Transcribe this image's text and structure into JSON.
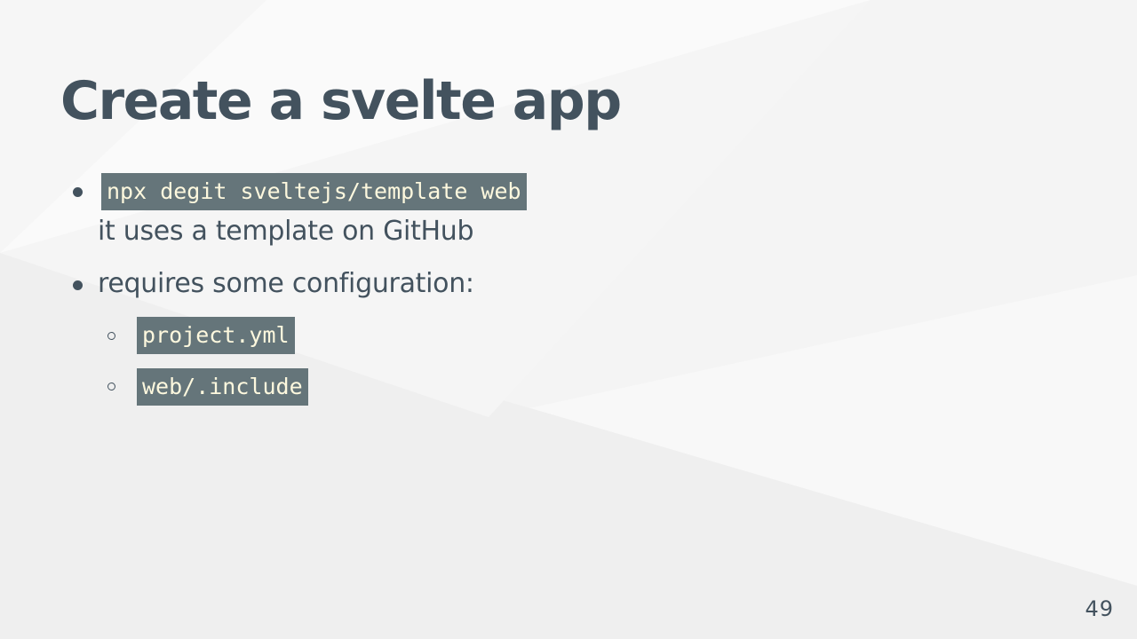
{
  "slide": {
    "title": "Create a svelte app",
    "bullets": [
      {
        "code": "npx degit sveltejs/template web",
        "text": "it uses a template on GitHub"
      },
      {
        "text": "requires some configuration:",
        "sub_items": [
          {
            "code": "project.yml"
          },
          {
            "code": "web/.include"
          }
        ]
      }
    ],
    "page_number": "49"
  },
  "colors": {
    "text": "#43525e",
    "code_background": "#65757a",
    "code_text": "#fdf8de",
    "background": "#f3f3f3"
  }
}
